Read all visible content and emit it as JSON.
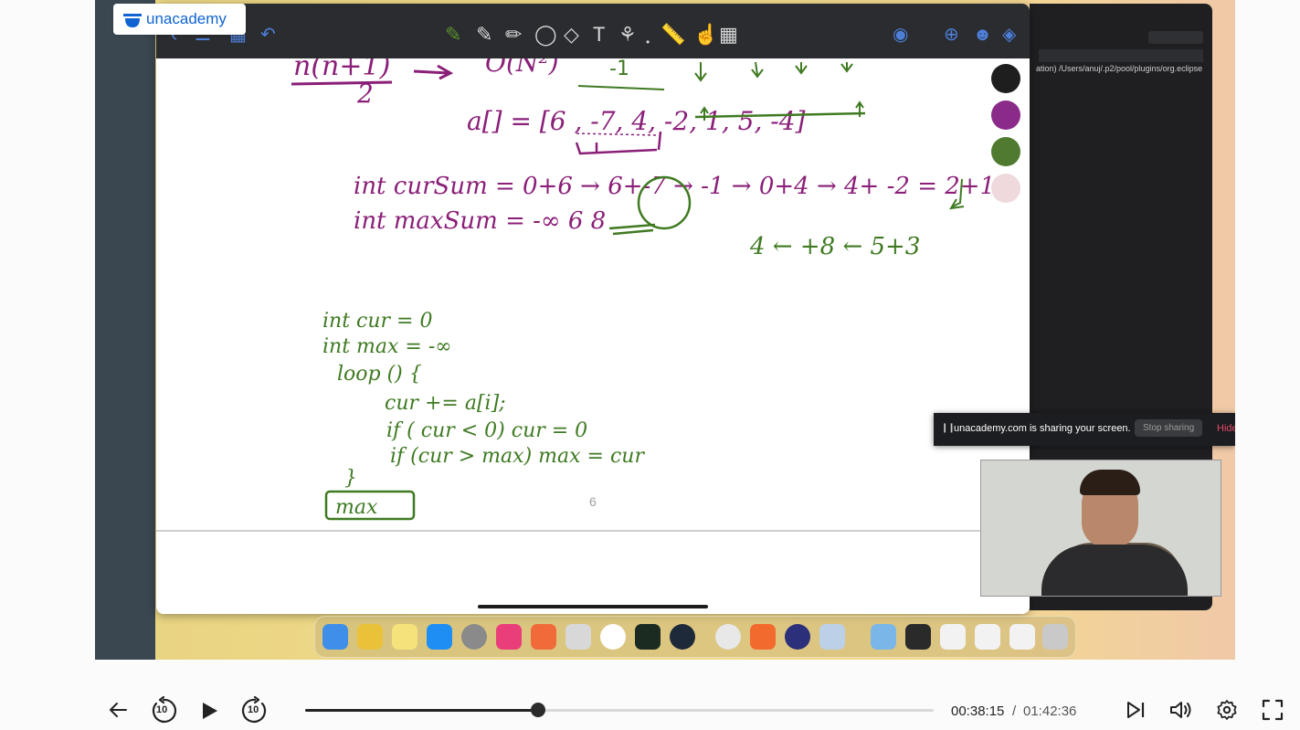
{
  "brand": {
    "logo_text": "unacademy",
    "color": "#0f64d2"
  },
  "lecture": {
    "page_number": "6",
    "handwriting": {
      "line1": "n(n+1)",
      "line1_denominator": "2",
      "complexity": "O(N²)",
      "array": "a[] = [6 , -7, 4, -2, 1, 5, -4]",
      "cursum": "int  curSum = 0+6 → 6+-7 → -1 → 0+4 → 4+ -2 = 2+1",
      "maxsum": "int  maxSum = -∞ 6 8",
      "sum_note": "4 ← +8 ← 5+3",
      "code_lines": [
        "int cur = 0",
        "int max = -∞",
        "loop () {",
        "cur += a[i];",
        "if ( cur < 0)  cur = 0",
        "if (cur > max)  max = cur",
        "}"
      ],
      "boxed": "max"
    }
  },
  "desktop": {
    "eclipse_path": "ation) /Users/anuj/.p2/pool/plugins/org.eclipse",
    "share_notice": {
      "message": "unacademy.com is sharing your screen.",
      "stop_label": "Stop sharing",
      "hide_label": "Hide"
    }
  },
  "player": {
    "current_time": "00:38:15",
    "separator": "/",
    "total_time": "01:42:36",
    "progress": 0.37,
    "rewind_label": "10",
    "forward_label": "10"
  },
  "colors": {
    "ink_purple": "#8a1f78",
    "ink_green": "#3f7a22",
    "toolbar_icon_blue": "#4e7fd8",
    "toolbar_tool": "#d7d7d7"
  }
}
